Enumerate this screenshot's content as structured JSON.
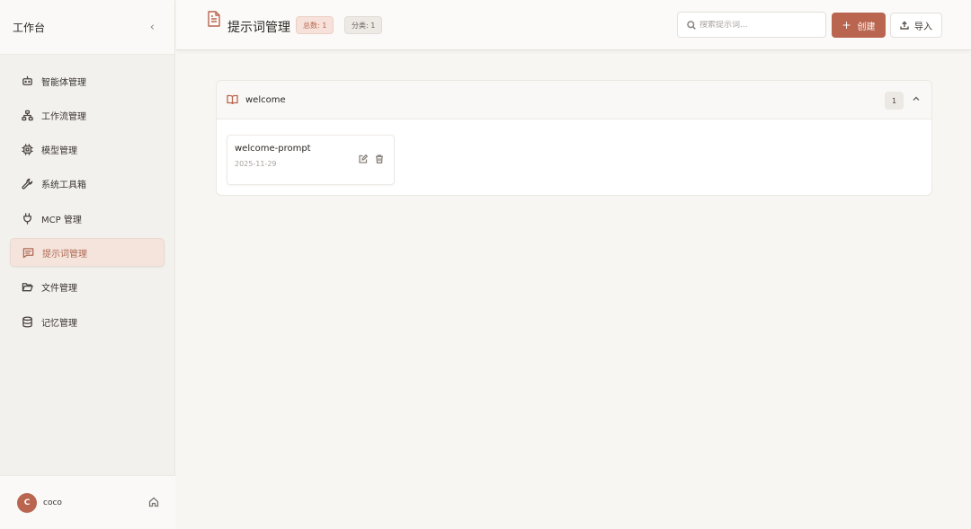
{
  "sidebar": {
    "title": "工作台",
    "collapse_icon": "chevron-left-icon",
    "items": [
      {
        "label": "智能体管理",
        "icon": "bot-icon",
        "active": false
      },
      {
        "label": "工作流管理",
        "icon": "workflow-icon",
        "active": false
      },
      {
        "label": "模型管理",
        "icon": "chip-icon",
        "active": false
      },
      {
        "label": "系统工具箱",
        "icon": "wrench-icon",
        "active": false
      },
      {
        "label": "MCP 管理",
        "icon": "plug-icon",
        "active": false
      },
      {
        "label": "提示词管理",
        "icon": "message-text-icon",
        "active": true
      },
      {
        "label": "文件管理",
        "icon": "folder-open-icon",
        "active": false
      },
      {
        "label": "记忆管理",
        "icon": "database-icon",
        "active": false
      }
    ],
    "user": {
      "initial": "C",
      "name": "coco"
    }
  },
  "header": {
    "title": "提示词管理",
    "total_badge": "总数: 1",
    "category_badge": "分类: 1",
    "search_placeholder": "搜索提示词...",
    "create_label": "创建",
    "import_label": "导入"
  },
  "groups": [
    {
      "name": "welcome",
      "count": "1",
      "prompts": [
        {
          "name": "welcome-prompt",
          "date": "2025-11-29"
        }
      ]
    }
  ],
  "colors": {
    "accent": "#b9654f",
    "active_bg": "#f4e4dc",
    "background": "#f8f6f3"
  }
}
